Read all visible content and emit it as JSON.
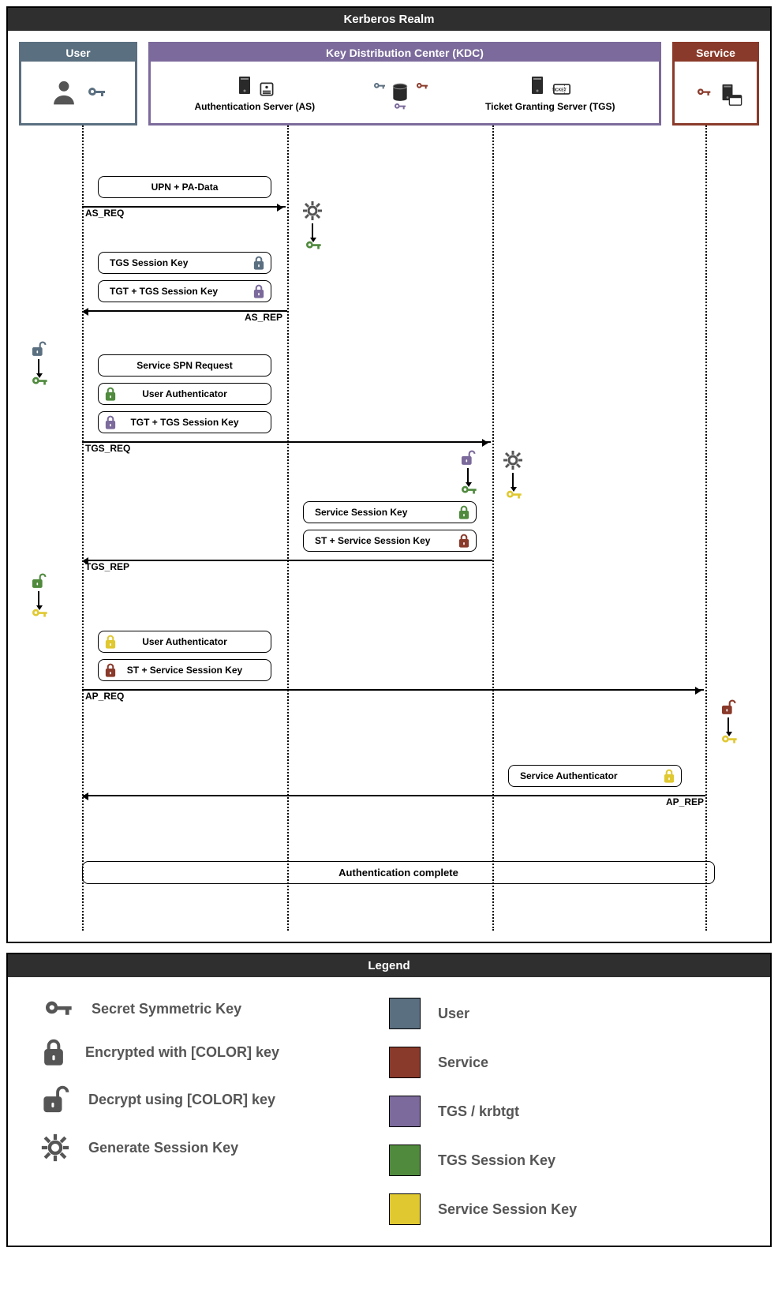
{
  "realm_title": "Kerberos Realm",
  "legend_title": "Legend",
  "participants": {
    "user": "User",
    "kdc": "Key Distribution Center (KDC)",
    "as": "Authentication Server (AS)",
    "tgs": "Ticket Granting Server (TGS)",
    "service": "Service"
  },
  "messages": {
    "upn": "UPN + PA-Data",
    "as_req": "AS_REQ",
    "tgs_sess": "TGS Session Key",
    "tgt_sess": "TGT +  TGS Session Key",
    "as_rep": "AS_REP",
    "spn": "Service SPN Request",
    "user_auth": "User Authenticator",
    "tgt_sess2": "TGT + TGS Session Key",
    "tgs_req": "TGS_REQ",
    "svc_sess": "Service Session Key",
    "st_sess": "ST + Service Session Key",
    "tgs_rep": "TGS_REP",
    "user_auth2": "User Authenticator",
    "st_sess2": "ST + Service Session Key",
    "ap_req": "AP_REQ",
    "svc_auth": "Service Authenticator",
    "ap_rep": "AP_REP",
    "complete": "Authentication complete"
  },
  "legend": {
    "key": "Secret Symmetric Key",
    "enc": "Encrypted with [COLOR] key",
    "dec": "Decrypt using [COLOR] key",
    "gen": "Generate Session Key",
    "user": "User",
    "service": "Service",
    "tgs": "TGS / krbtgt",
    "tgssess": "TGS Session Key",
    "svcsess": "Service Session Key"
  },
  "colors": {
    "user": "#5a6f80",
    "service": "#8a3a2a",
    "tgs": "#7b6a9b",
    "tgssess": "#4f8a3d",
    "svcsess": "#e0c830",
    "grey": "#555"
  }
}
